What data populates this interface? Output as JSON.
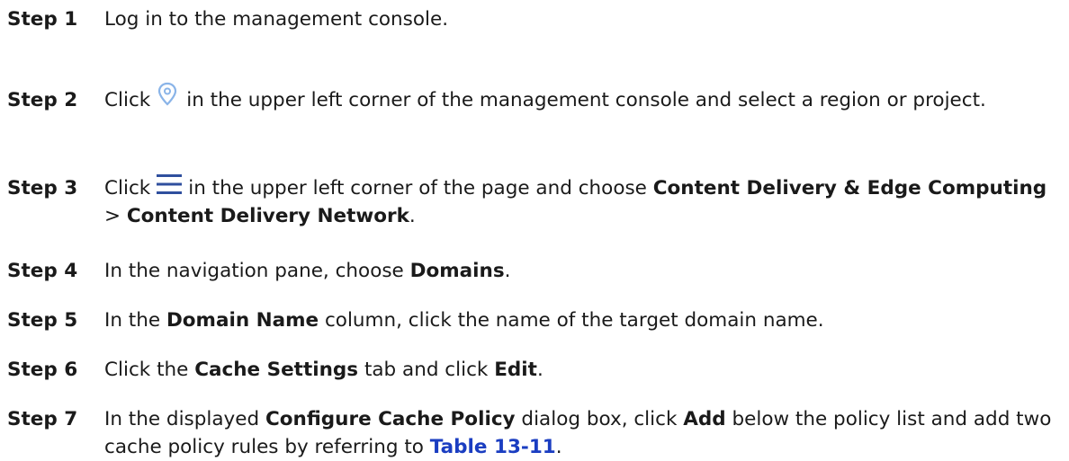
{
  "steps": [
    {
      "label": "Step 1",
      "text": "Log in to the management console."
    },
    {
      "label": "Step 2",
      "pre": "Click",
      "icon": "location-pin-icon",
      "post": "in the upper left corner of the management console and select a region or project."
    },
    {
      "label": "Step 3",
      "pre": "Click",
      "icon": "menu-icon",
      "mid": "in the upper left corner of the page and choose",
      "bold1": "Content Delivery & Edge Computing",
      "sep": ">",
      "bold2": "Content Delivery Network",
      "end": "."
    },
    {
      "label": "Step 4",
      "pre": "In the navigation pane, choose",
      "bold1": "Domains",
      "end": "."
    },
    {
      "label": "Step 5",
      "pre": "In the",
      "bold1": "Domain Name",
      "post": "column, click the name of the target domain name."
    },
    {
      "label": "Step 6",
      "pre": "Click the",
      "bold1": "Cache Settings",
      "mid": "tab and click",
      "bold2": "Edit",
      "end": "."
    },
    {
      "label": "Step 7",
      "pre": "In the displayed",
      "bold1": "Configure Cache Policy",
      "mid": "dialog box, click",
      "bold2": "Add",
      "post": "below the policy list and add two cache policy rules by referring to",
      "link": "Table 13-11",
      "end": "."
    }
  ],
  "colors": {
    "text": "#1a1a1a",
    "link": "#1a3dc1",
    "pin_icon": "#8ab4e8",
    "menu_icon": "#2f4f9e"
  }
}
